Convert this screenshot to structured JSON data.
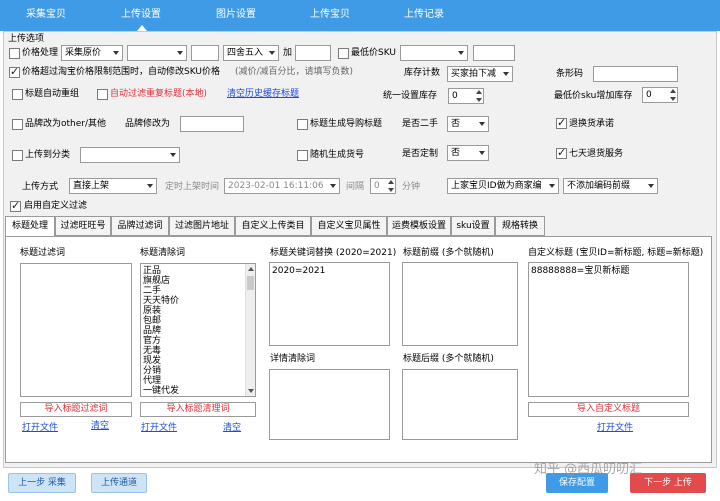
{
  "nav": {
    "tabs": [
      "采集宝贝",
      "上传设置",
      "图片设置",
      "上传宝贝",
      "上传记录"
    ],
    "active": 1
  },
  "options": {
    "section_title": "上传选项",
    "price_processing": "价格处理",
    "price_source": "采集原价",
    "price_op": "",
    "price_value": "",
    "rounding": "四舍五入",
    "add_label": "加",
    "add_value": "",
    "min_sku_label": "最低价SKU",
    "min_sku_select": "",
    "min_sku_value": "",
    "auto_price_label": "价格超过淘宝价格限制范围时，自动修改SKU价格",
    "auto_price_hint": "(减价/减百分比，请填写负数)",
    "stock_count_label": "库存计数",
    "stock_count_value": "买家拍下减",
    "barcode_label": "条形码",
    "barcode_value": "",
    "title_dedupe": "标题自动重组",
    "auto_filter_dup": "自动过滤重复标题(本地)",
    "clear_history": "清空历史缓存标题",
    "unify_stock_label": "统一设置库存",
    "unify_stock_value": "0",
    "min_sku_stock_label": "最低价sku增加库存",
    "min_sku_stock_value": "0",
    "brand_other": "品牌改为other/其他",
    "brand_change_label": "品牌修改为",
    "brand_change_value": "",
    "title_gen_brand": "标题生成导购标题",
    "second_hand_label": "是否二手",
    "second_hand_value": "否",
    "return_commit": "退换货承诺",
    "upload_category": "上传到分类",
    "category_value": "",
    "random_sku": "随机生成货号",
    "custom_made_label": "是否定制",
    "custom_made_value": "否",
    "seven_day": "七天退货服务",
    "upload_mode_label": "上传方式",
    "upload_mode_value": "直接上架",
    "schedule_label": "定时上架时间",
    "schedule_value": "2023-02-01 16:11:06",
    "interval_label": "间隔",
    "interval_value": "0",
    "minute_label": "分钟",
    "merchant_code": "上家宝贝ID做为商家编",
    "prefix_option": "不添加编码前缀",
    "enable_filter": "启用自定义过滤"
  },
  "checks": {
    "price_processing": false,
    "min_sku": false,
    "auto_price": true,
    "title_dedupe": false,
    "auto_filter_dup": false,
    "brand_other": false,
    "title_gen_brand": false,
    "return_commit": true,
    "upload_category": false,
    "random_sku": false,
    "seven_day": true,
    "enable_filter": true
  },
  "subtabs": [
    "标题处理",
    "过滤旺旺号",
    "品牌过滤词",
    "过滤图片地址",
    "自定义上传类目",
    "自定义宝贝属性",
    "运费模板设置",
    "sku设置",
    "规格转换"
  ],
  "title_panel": {
    "filter_words_label": "标题过滤词",
    "filter_words": [],
    "clean_words_label": "标题清除词",
    "clean_words": [
      "正品",
      "旗舰店",
      "二手",
      "天天特价",
      "原装",
      "包邮",
      "品牌",
      "官方",
      "无毒",
      "现发",
      "分销",
      "代理",
      "一键代发"
    ],
    "replace_label": "标题关键词替换 (2020=2021)",
    "replace_value": "2020=2021",
    "detail_clear_label": "详情清除词",
    "prefix_label": "标题前缀 (多个就随机)",
    "suffix_label": "标题后缀 (多个就随机)",
    "custom_title_label": "自定义标题 (宝贝ID=新标题, 标题=新标题)",
    "custom_title_value": "88888888=宝贝新标题",
    "import_filter_btn": "导入标题过滤词",
    "import_clean_btn": "导入标题清理词",
    "import_custom_btn": "导入自定义标题",
    "open_file": "打开文件",
    "clear": "清空"
  },
  "bottom": {
    "prev_collect": "上一步 采集",
    "upload_channel": "上传通道",
    "save_config": "保存配置",
    "next_upload": "下一步 上传"
  },
  "watermark": "知乎 @西瓜叨叨汇"
}
